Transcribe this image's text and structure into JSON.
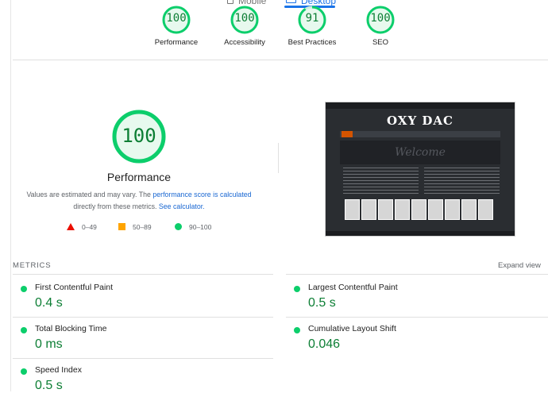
{
  "tabs": {
    "mobile": "Mobile",
    "desktop": "Desktop"
  },
  "scores": [
    {
      "label": "Performance",
      "value": "100",
      "fraction": 1.0
    },
    {
      "label": "Accessibility",
      "value": "100",
      "fraction": 1.0
    },
    {
      "label": "Best Practices",
      "value": "91",
      "fraction": 0.91
    },
    {
      "label": "SEO",
      "value": "100",
      "fraction": 1.0
    }
  ],
  "performance": {
    "score": "100",
    "title": "Performance",
    "note_prefix": "Values are estimated and may vary. The ",
    "note_link1": "performance score is calculated",
    "note_middle": " directly from these metrics. ",
    "note_link2": "See calculator."
  },
  "legend": {
    "fail": "0–49",
    "average": "50–89",
    "pass": "90–100"
  },
  "preview": {
    "site_logo": "OXY DAC",
    "welcome": "Welcome"
  },
  "metrics": {
    "title": "METRICS",
    "expand": "Expand view",
    "items": [
      {
        "name": "First Contentful Paint",
        "value": "0.4 s"
      },
      {
        "name": "Largest Contentful Paint",
        "value": "0.5 s"
      },
      {
        "name": "Total Blocking Time",
        "value": "0 ms"
      },
      {
        "name": "Cumulative Layout Shift",
        "value": "0.046"
      },
      {
        "name": "Speed Index",
        "value": "0.5 s"
      }
    ]
  },
  "colors": {
    "pass": "#0cce6b",
    "pass_text": "#0c7e34",
    "average": "#ffa400",
    "fail": "#eb0f00",
    "link": "#1967d2",
    "accent": "#1a73e8"
  }
}
